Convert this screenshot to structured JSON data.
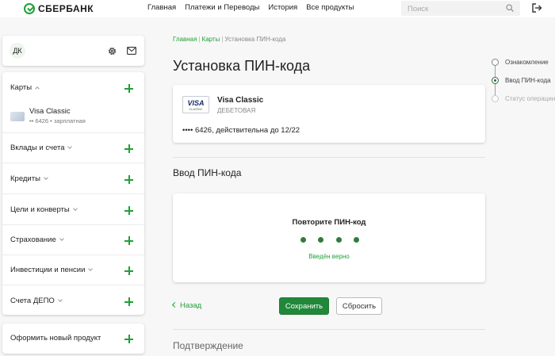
{
  "brand": {
    "name": "СБЕРБАНК",
    "color": "#21a038"
  },
  "topnav": [
    "Главная",
    "Платежи и Переводы",
    "История",
    "Все продукты"
  ],
  "search": {
    "placeholder": "Поиск"
  },
  "profile": {
    "initials": "ДК"
  },
  "products": {
    "items": [
      {
        "label": "Карты",
        "expanded": true
      },
      {
        "label": "Вклады и счета"
      },
      {
        "label": "Кредиты"
      },
      {
        "label": "Цели и конверты"
      },
      {
        "label": "Страхование"
      },
      {
        "label": "Инвестиции и пенсии"
      },
      {
        "label": "Счета ДЕПО"
      }
    ],
    "card": {
      "name": "Visa Classic",
      "info": "•• 6426 • зарплатная"
    }
  },
  "new_product": "Оформить новый продукт",
  "breadcrumb": {
    "home": "Главная",
    "cards": "Карты",
    "current": "Установка ПИН-кода"
  },
  "page_title": "Установка ПИН-кода",
  "card_info": {
    "logo_main": "VISA",
    "logo_sub": "CLASSIC",
    "name": "Visa Classic",
    "type": "ДЕБЕТОВАЯ",
    "number": "•••• 6426, действительна до 12/22"
  },
  "pin_section": {
    "title": "Ввод ПИН-кода",
    "label": "Повторите ПИН-код",
    "status": "Введён верно",
    "digits_entered": 4
  },
  "actions": {
    "back": "Назад",
    "save": "Сохранить",
    "reset": "Сбросить"
  },
  "confirm_title": "Подтверждение",
  "steps": [
    {
      "label": "Ознакомление",
      "state": "done"
    },
    {
      "label": "Ввод ПИН-кода",
      "state": "active"
    },
    {
      "label": "Статус операции",
      "state": "future"
    }
  ]
}
